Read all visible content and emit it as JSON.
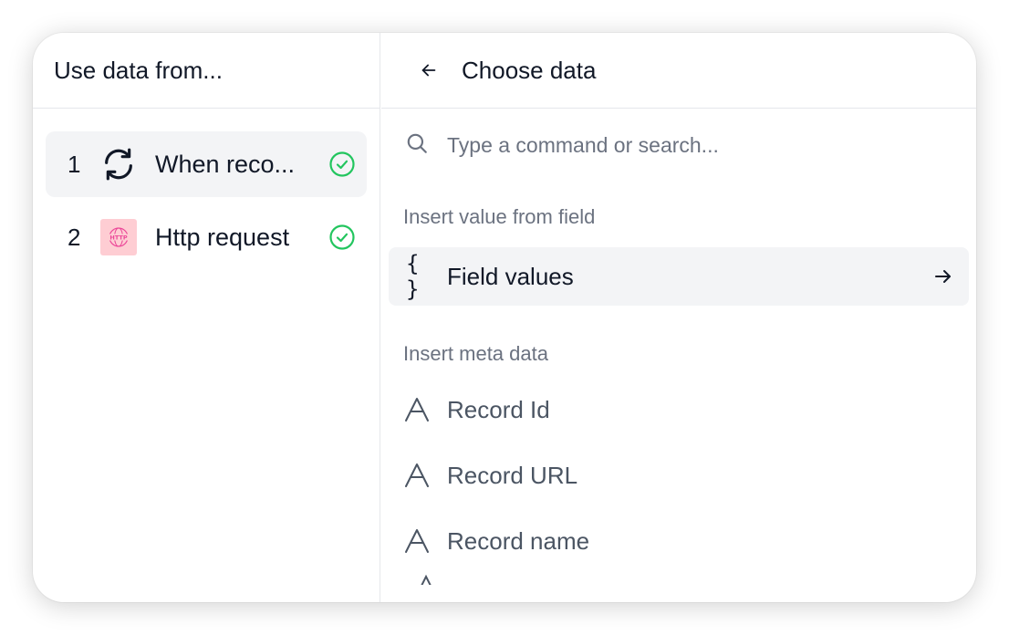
{
  "left_panel": {
    "title": "Use data from...",
    "steps": [
      {
        "number": "1",
        "icon": "refresh-icon",
        "label": "When reco...",
        "status": "check-circle-icon",
        "selected": true
      },
      {
        "number": "2",
        "icon": "http-icon",
        "label": "Http request",
        "status": "check-circle-icon",
        "selected": false
      }
    ]
  },
  "right_panel": {
    "title": "Choose data",
    "back_icon": "arrow-left-icon",
    "search": {
      "placeholder": "Type a command or search...",
      "value": "",
      "icon": "search-icon"
    },
    "section_field": "Insert value from field",
    "field_values": {
      "icon_text": "{ }",
      "label": "Field values",
      "arrow": "arrow-right-icon"
    },
    "section_meta": "Insert meta data",
    "meta_items": [
      {
        "label": "Record Id",
        "icon": "text-type-icon"
      },
      {
        "label": "Record URL",
        "icon": "text-type-icon"
      },
      {
        "label": "Record name",
        "icon": "text-type-icon"
      }
    ]
  },
  "colors": {
    "success": "#22c55e",
    "http_badge_bg": "#fecdd3",
    "http_badge_fg": "#ec4899",
    "hover_bg": "#f3f4f6",
    "muted_text": "#6b7280"
  }
}
